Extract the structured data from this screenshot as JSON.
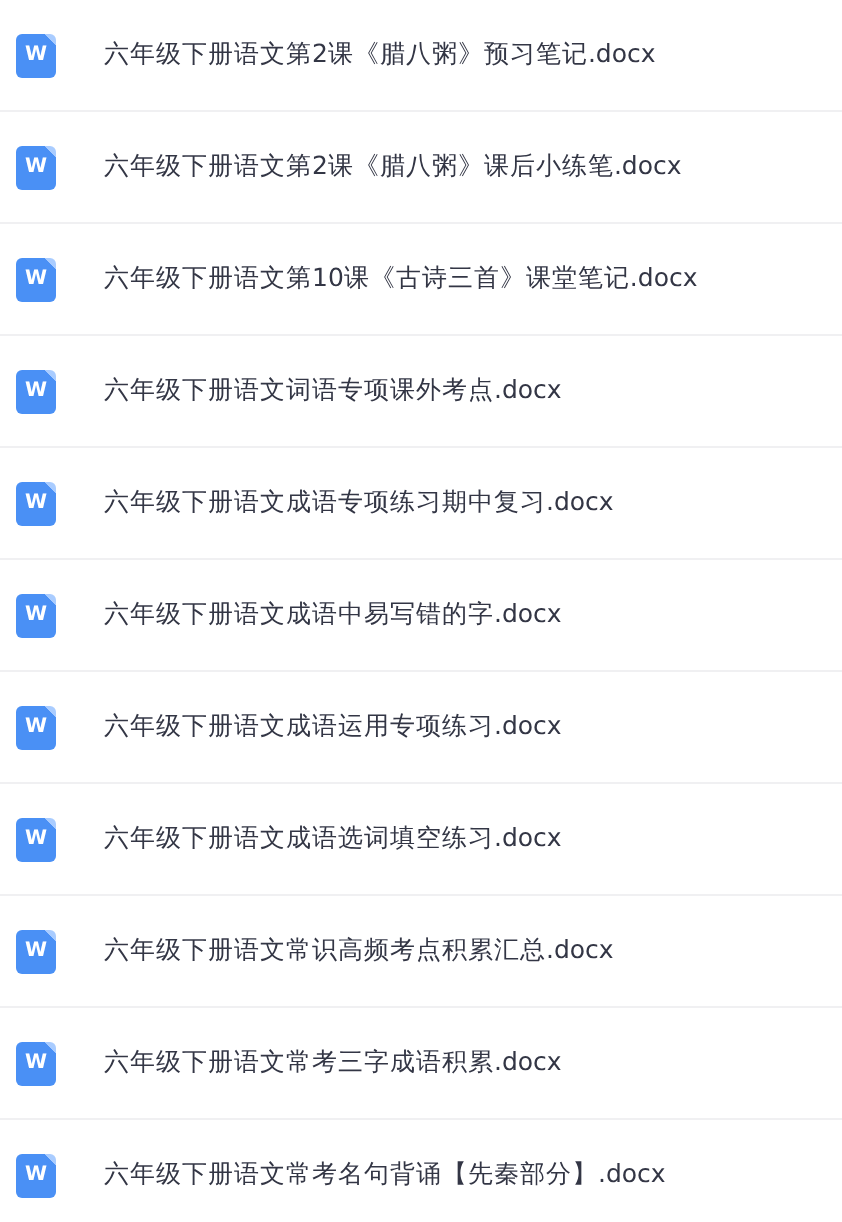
{
  "files": [
    {
      "icon": "W",
      "name": "六年级下册语文第2课《腊八粥》预习笔记.docx"
    },
    {
      "icon": "W",
      "name": "六年级下册语文第2课《腊八粥》课后小练笔.docx"
    },
    {
      "icon": "W",
      "name": "六年级下册语文第10课《古诗三首》课堂笔记.docx"
    },
    {
      "icon": "W",
      "name": "六年级下册语文词语专项课外考点.docx"
    },
    {
      "icon": "W",
      "name": "六年级下册语文成语专项练习期中复习.docx"
    },
    {
      "icon": "W",
      "name": "六年级下册语文成语中易写错的字.docx"
    },
    {
      "icon": "W",
      "name": "六年级下册语文成语运用专项练习.docx"
    },
    {
      "icon": "W",
      "name": "六年级下册语文成语选词填空练习.docx"
    },
    {
      "icon": "W",
      "name": "六年级下册语文常识高频考点积累汇总.docx"
    },
    {
      "icon": "W",
      "name": "六年级下册语文常考三字成语积累.docx"
    },
    {
      "icon": "W",
      "name": "六年级下册语文常考名句背诵【先秦部分】.docx"
    }
  ]
}
